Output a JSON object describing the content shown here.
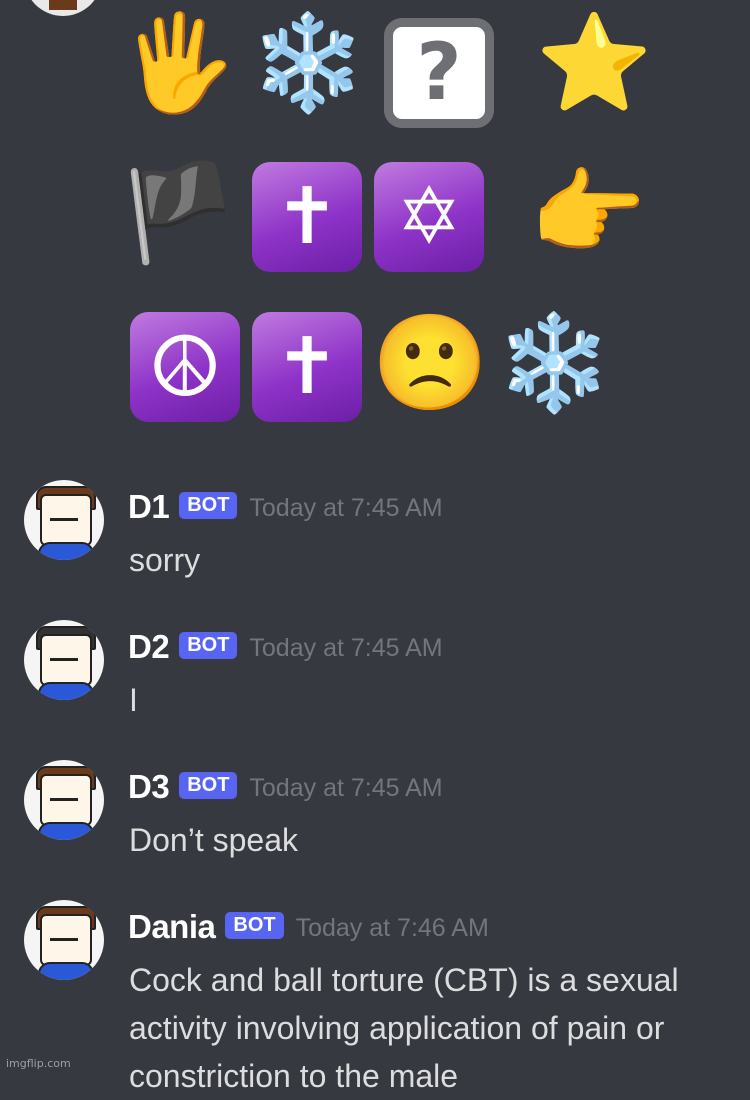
{
  "emoji_rows": [
    [
      "🖐️",
      "❄️",
      "?",
      "⭐"
    ],
    [
      "🏴",
      "✝",
      "✡",
      "👉"
    ],
    [
      "☮",
      "✝",
      "🙁",
      "❄️"
    ]
  ],
  "messages": [
    {
      "username": "D1",
      "tag": "BOT",
      "timestamp": "Today at 7:45 AM",
      "text": "sorry"
    },
    {
      "username": "D2",
      "tag": "BOT",
      "timestamp": "Today at 7:45 AM",
      "text": "I"
    },
    {
      "username": "D3",
      "tag": "BOT",
      "timestamp": "Today at 7:45 AM",
      "text": "Don’t speak"
    },
    {
      "username": "Dania",
      "tag": "BOT",
      "timestamp": "Today at 7:46 AM",
      "text": "Cock and ball torture (CBT) is a sexual activity involving application of pain or constriction to the male"
    }
  ],
  "watermark": "imgflip.com",
  "colors": {
    "background": "#36393f",
    "bot_tag": "#5865f2",
    "username": "#ffffff",
    "timestamp": "#72767d",
    "message_text": "#dcddde"
  }
}
